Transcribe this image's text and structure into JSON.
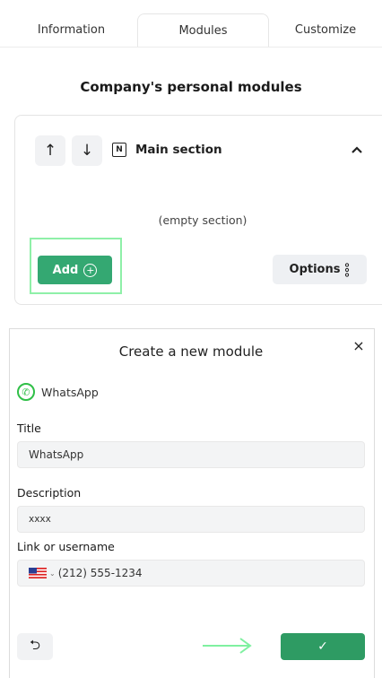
{
  "tabs": [
    {
      "label": "Information"
    },
    {
      "label": "Modules",
      "active": true
    },
    {
      "label": "Customize"
    }
  ],
  "page_heading": "Company's personal modules",
  "section": {
    "title": "Main section",
    "empty_text": "(empty section)",
    "add_label": "Add",
    "options_label": "Options"
  },
  "modal": {
    "title": "Create a new module",
    "close_symbol": "×",
    "module_type": "WhatsApp",
    "title_label": "Title",
    "title_value": "WhatsApp",
    "description_label": "Description",
    "description_value": "xxxx",
    "link_label": "Link or username",
    "phone_placeholder": "(212) 555-1234",
    "confirm_symbol": "✓",
    "undo_symbol": "⮌"
  },
  "colors": {
    "add_button": "#34a872",
    "confirm_button": "#2e9b63",
    "highlight": "#8ff0a8",
    "whatsapp": "#2fbf47"
  },
  "icons": [
    "arrow-up-icon",
    "arrow-down-icon",
    "notion-icon",
    "chevron-up-icon",
    "plus-circle-icon",
    "kebab-icon",
    "close-icon",
    "whatsapp-icon",
    "us-flag-icon",
    "undo-icon",
    "check-icon"
  ]
}
